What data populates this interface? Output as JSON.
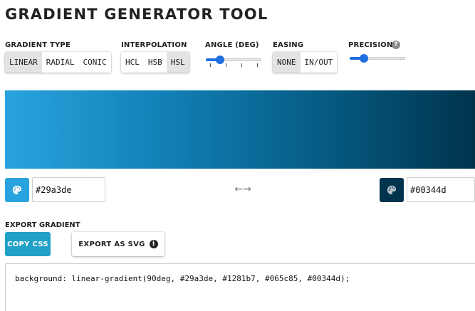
{
  "title": "GRADIENT GENERATOR TOOL",
  "gradient_type": {
    "label": "GRADIENT TYPE",
    "options": [
      "LINEAR",
      "RADIAL",
      "CONIC"
    ],
    "selected": "LINEAR"
  },
  "interpolation": {
    "label": "INTERPOLATION",
    "options": [
      "HCL",
      "HSB",
      "HSL"
    ],
    "selected": "HSL"
  },
  "angle": {
    "label": "ANGLE (DEG)",
    "level": 0.25,
    "ticks": 4
  },
  "easing": {
    "label": "EASING",
    "options": [
      "NONE",
      "IN/OUT"
    ],
    "selected": "NONE"
  },
  "precision": {
    "label": "PRECISION",
    "help_icon": "question-circle-icon",
    "help_glyph": "?",
    "level": 0.25
  },
  "preview_colors": [
    "#29a3de",
    "#1281b7",
    "#065c85",
    "#00344d"
  ],
  "start_color": {
    "hex": "#29a3de",
    "icon": "palette-icon"
  },
  "swap_icon": {
    "name": "swap-arrows-icon",
    "glyph": "←→"
  },
  "end_color": {
    "hex": "#00344d",
    "icon": "palette-icon"
  },
  "export": {
    "label": "EXPORT GRADIENT",
    "copy_css_label": "COPY CSS",
    "export_svg_label": "EXPORT AS SVG",
    "info_icon": "info-circle-icon",
    "info_glyph": "i",
    "accent_color": "#21a0c7"
  },
  "code": "background: linear-gradient(90deg, #29a3de, #1281b7, #065c85, #00344d);"
}
